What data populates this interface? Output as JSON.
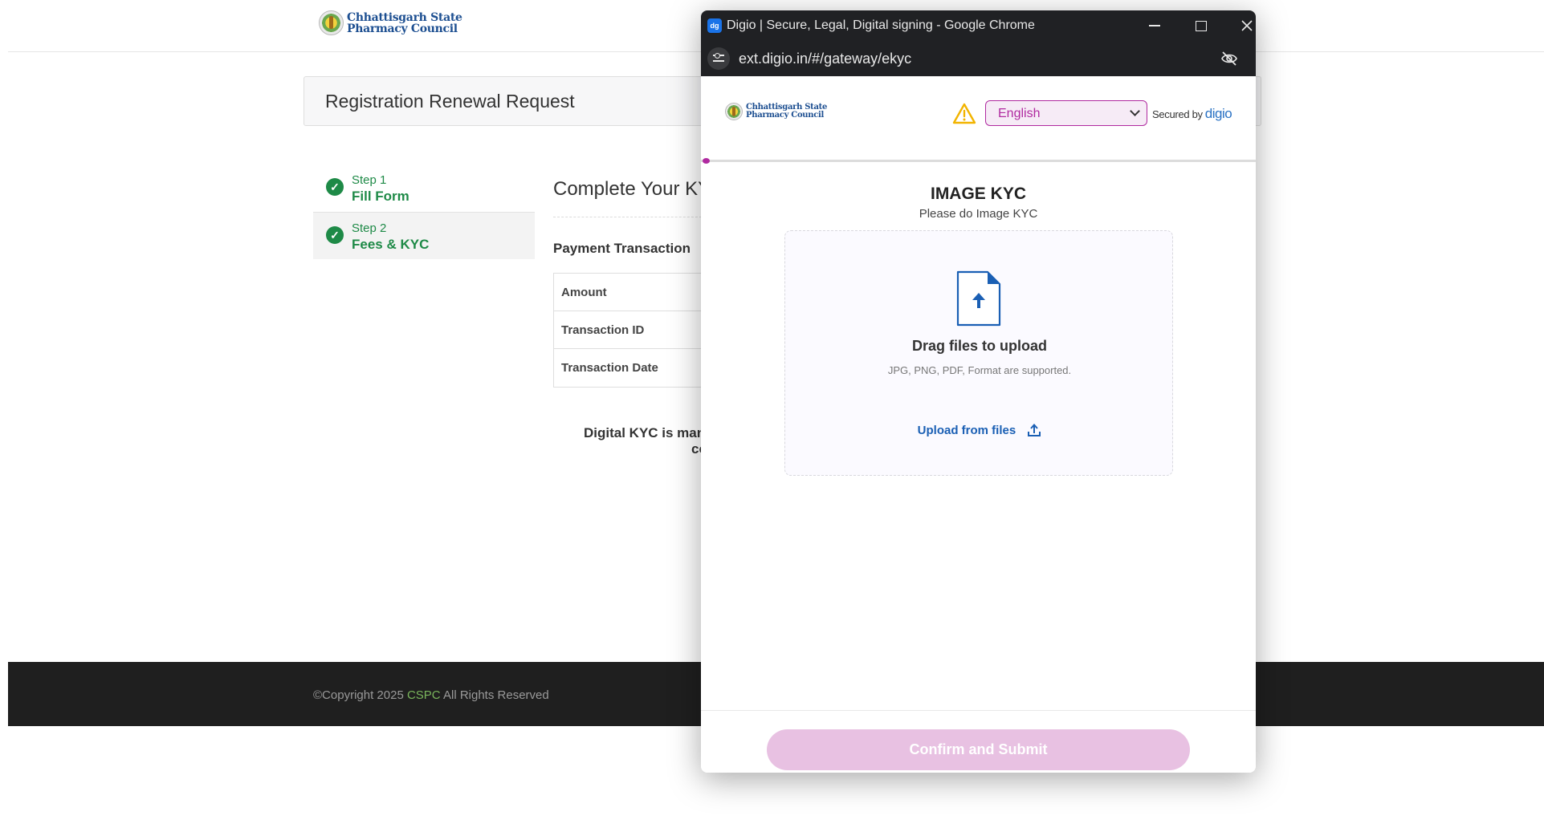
{
  "site": {
    "logo": {
      "line1": "Chhattisgarh State",
      "line2": "Pharmacy Council"
    },
    "page_title": "Registration Renewal Request",
    "steps": [
      {
        "num": "Step 1",
        "title": "Fill Form"
      },
      {
        "num": "Step 2",
        "title": "Fees & KYC"
      }
    ],
    "kyc_heading": "Complete Your KYC",
    "payment_label": "Payment Transaction",
    "payment_rows": [
      "Amount",
      "Transaction ID",
      "Transaction Date"
    ],
    "note_line1": "Digital KYC is mandatory",
    "note_line2": "co",
    "footer": {
      "prefix": "©Copyright 2025",
      "brand": "CSPC",
      "suffix": "All Rights Reserved"
    }
  },
  "popup": {
    "window_title": "Digio | Secure, Legal, Digital signing - Google Chrome",
    "favicon_text": "dg",
    "url": "ext.digio.in/#/gateway/ekyc",
    "logo": {
      "line1": "Chhattisgarh State",
      "line2": "Pharmacy Council"
    },
    "language": "English",
    "secured_by": "Secured by",
    "secured_brand": "digio",
    "title": "IMAGE KYC",
    "subtitle": "Please do Image KYC",
    "drop_title": "Drag files to upload",
    "drop_sub": "JPG, PNG, PDF, Format are supported.",
    "upload_link": "Upload from files",
    "confirm_button": "Confirm and Submit",
    "colors": {
      "accent": "#b02aa0",
      "link": "#1a5fb4",
      "button_disabled": "#e8c1e2",
      "chrome": "#202124"
    }
  }
}
